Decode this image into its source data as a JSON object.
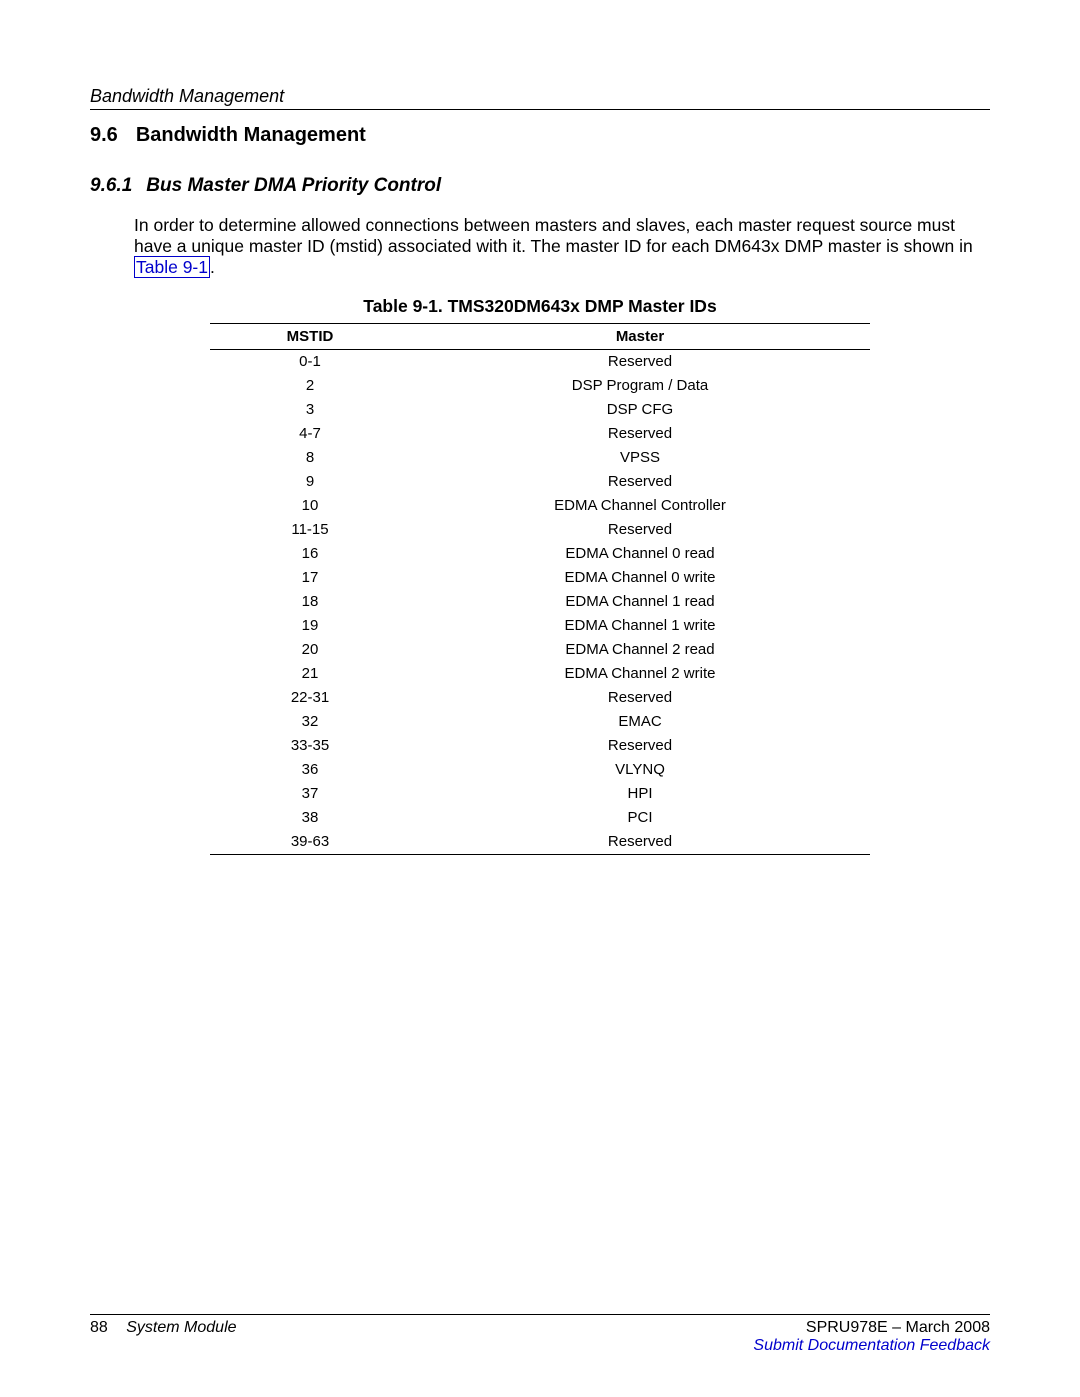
{
  "header": {
    "running_title": "Bandwidth Management"
  },
  "section": {
    "number": "9.6",
    "title": "Bandwidth Management"
  },
  "subsection": {
    "number": "9.6.1",
    "title": "Bus Master DMA Priority Control"
  },
  "paragraph": {
    "pre": "In order to determine allowed connections between masters and slaves, each master request source must have a unique master ID (mstid) associated with it. The master ID for each DM643x DMP master is shown in ",
    "ref": "Table 9-1",
    "post": "."
  },
  "table": {
    "caption": "Table 9-1. TMS320DM643x DMP Master IDs",
    "headers": {
      "mstid": "MSTID",
      "master": "Master"
    },
    "rows": [
      {
        "mstid": "0-1",
        "master": "Reserved"
      },
      {
        "mstid": "2",
        "master": "DSP Program / Data"
      },
      {
        "mstid": "3",
        "master": "DSP CFG"
      },
      {
        "mstid": "4-7",
        "master": "Reserved"
      },
      {
        "mstid": "8",
        "master": "VPSS"
      },
      {
        "mstid": "9",
        "master": "Reserved"
      },
      {
        "mstid": "10",
        "master": "EDMA Channel Controller"
      },
      {
        "mstid": "11-15",
        "master": "Reserved"
      },
      {
        "mstid": "16",
        "master": "EDMA Channel 0 read"
      },
      {
        "mstid": "17",
        "master": "EDMA Channel 0 write"
      },
      {
        "mstid": "18",
        "master": "EDMA Channel 1 read"
      },
      {
        "mstid": "19",
        "master": "EDMA Channel 1 write"
      },
      {
        "mstid": "20",
        "master": "EDMA Channel 2 read"
      },
      {
        "mstid": "21",
        "master": "EDMA Channel 2 write"
      },
      {
        "mstid": "22-31",
        "master": "Reserved"
      },
      {
        "mstid": "32",
        "master": "EMAC"
      },
      {
        "mstid": "33-35",
        "master": "Reserved"
      },
      {
        "mstid": "36",
        "master": "VLYNQ"
      },
      {
        "mstid": "37",
        "master": "HPI"
      },
      {
        "mstid": "38",
        "master": "PCI"
      },
      {
        "mstid": "39-63",
        "master": "Reserved"
      }
    ]
  },
  "footer": {
    "page_number": "88",
    "chapter": "System Module",
    "doc_id": "SPRU978E – March 2008",
    "feedback": "Submit Documentation Feedback"
  }
}
